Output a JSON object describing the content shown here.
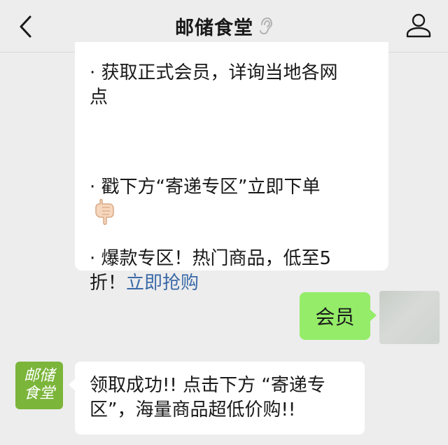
{
  "header": {
    "title": "邮储食堂",
    "back_icon": "chevron-left-icon",
    "voice_icon": "ear-icon",
    "profile_icon": "person-icon"
  },
  "messages": {
    "top": {
      "line1": "· 获取正式会员，详询当地各网",
      "line2": "点",
      "line3": "· 戳下方“寄递专区”立即下单",
      "emoji": "pointing-down-hand-icon",
      "line4": "· 爆款专区！热门商品，低至5",
      "line5_prefix": "折！",
      "line5_link": "立即抢购"
    },
    "mine": {
      "text": "会员"
    },
    "bot": {
      "avatar_line1": "邮储",
      "avatar_line2": "食堂",
      "line1": "领取成功!! 点击下方 “寄递专",
      "line2": "区”，海量商品超低价购!!"
    }
  },
  "colors": {
    "background": "#ededed",
    "my_bubble": "#95ec69",
    "bot_avatar": "#7bb53a",
    "link": "#3b6aa8"
  }
}
